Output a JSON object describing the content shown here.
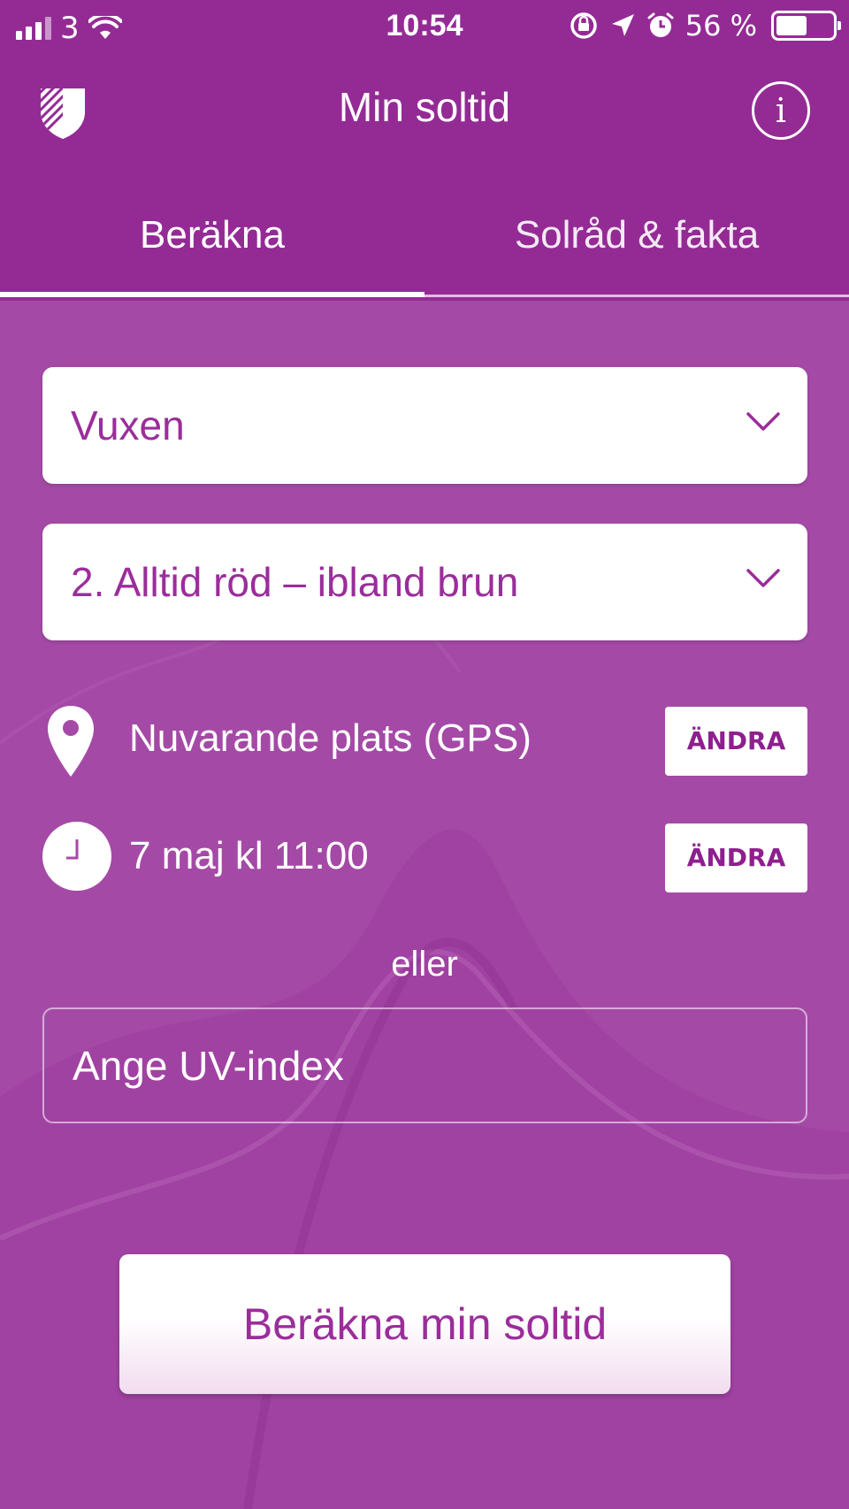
{
  "status_bar": {
    "carrier": "3",
    "time": "10:54",
    "battery_text": "56 %",
    "battery_level": 0.56
  },
  "nav": {
    "title": "Min soltid"
  },
  "tabs": [
    {
      "label": "Beräkna",
      "active": true
    },
    {
      "label": "Solråd & fakta",
      "active": false
    }
  ],
  "form": {
    "age_select": {
      "value": "Vuxen"
    },
    "skin_select": {
      "value": "2. Alltid röd – ibland brun"
    },
    "location": {
      "text": "Nuvarande plats (GPS)",
      "button": "ÄNDRA"
    },
    "datetime": {
      "text": "7 maj kl 11:00",
      "button": "ÄNDRA"
    },
    "or_text": "eller",
    "uv_input": {
      "placeholder": "Ange UV-index",
      "value": ""
    },
    "submit_label": "Beräkna min soltid"
  },
  "colors": {
    "header": "#942b95",
    "background": "#a44aa6",
    "accent_text": "#9b2d9b"
  },
  "icons": {
    "logo": "shield-icon",
    "info": "info-icon",
    "location": "location-pin-icon",
    "time": "clock-icon",
    "dropdown": "chevron-down-icon"
  }
}
